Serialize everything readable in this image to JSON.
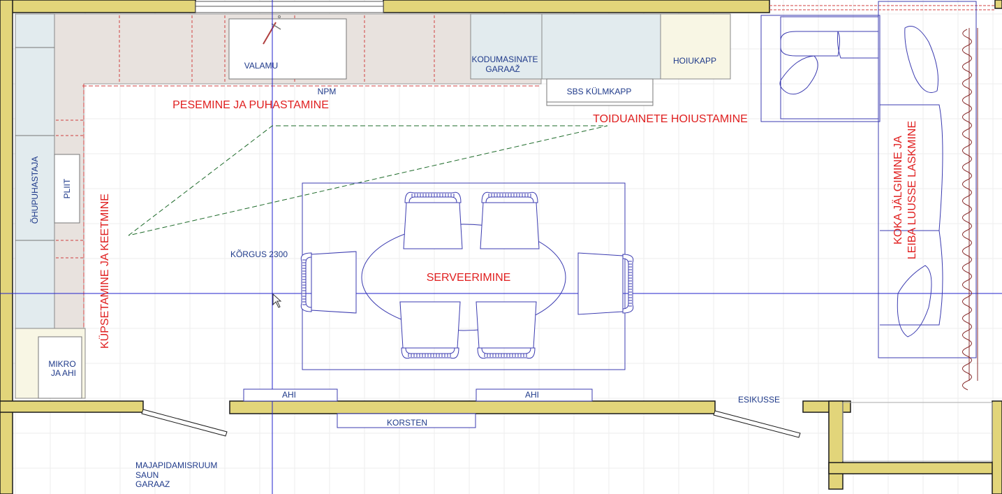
{
  "colors": {
    "wall_fill": "#e2d57a",
    "wall_stroke": "#1a1a1a",
    "counter": "#e8e2de",
    "cabinet": "#e2ebee",
    "storage": "#f8f6e4",
    "plan_line": "#3b3bb0",
    "guide_line": "#2222cc",
    "zone_text": "#e02020",
    "label_text": "#1f3a8a",
    "grid": "#eeeeee",
    "triangle": "#1e6b2a",
    "window_red": "#d04040"
  },
  "labels": {
    "valamu": "VALAMU",
    "npm": "NPM",
    "kodumasinate_1": "KODUMASINATE",
    "kodumasinate_2": "GARAAŽ",
    "sbs": "SBS KÜLMKAPP",
    "hoiukapp": "HOIUKAPP",
    "ohupuhastaja": "ÕHUPUHASTAJA",
    "pliit": "PLIIT",
    "mikro_1": "MIKRO",
    "mikro_2": "JA AHI",
    "korgus": "KÕRGUS 2300",
    "ahi_left": "AHI",
    "ahi_right": "AHI",
    "korsten": "KORSTEN",
    "esikusse": "ESIKUSSE",
    "majapidamis_1": "MAJAPIDAMISRUUM",
    "majapidamis_2": "SAUN",
    "majapidamis_3": "GARAAZ"
  },
  "zones": {
    "pesemine": "PESEMINE JA PUHASTAMINE",
    "toiduainete": "TOIDUAINETE HOIUSTAMINE",
    "kupsetamine": "KÜPSETAMINE JA KEETMINE",
    "serveerimine": "SERVEERIMINE",
    "koka_1": "KOKA JÄLGIMINE JA",
    "koka_2": "LEIBA LUUSSE LASKMINE"
  }
}
